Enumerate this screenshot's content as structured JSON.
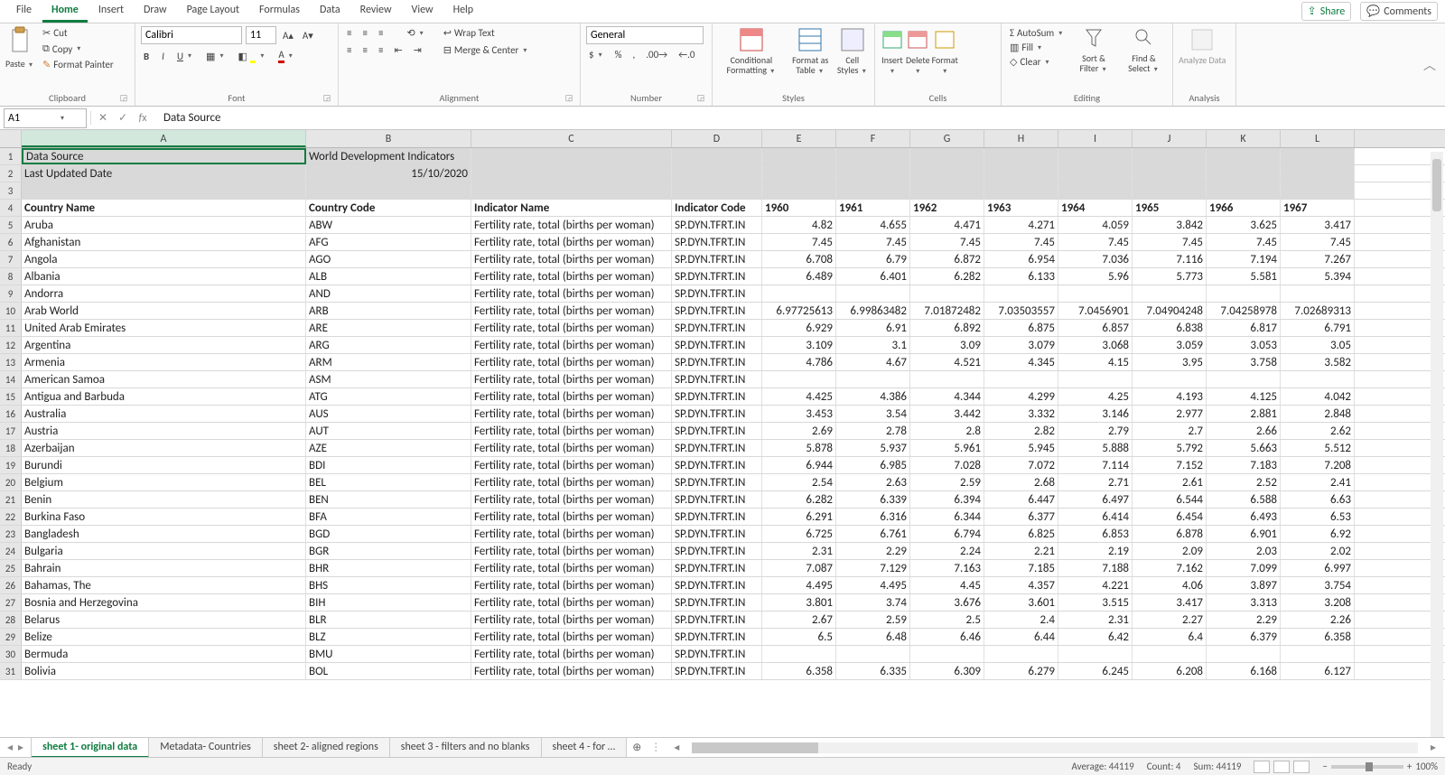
{
  "menu": {
    "tabs": [
      "File",
      "Home",
      "Insert",
      "Draw",
      "Page Layout",
      "Formulas",
      "Data",
      "Review",
      "View",
      "Help"
    ],
    "active": 1,
    "share": "Share",
    "comments": "Comments"
  },
  "ribbon": {
    "clipboard": {
      "paste": "Paste",
      "cut": "Cut",
      "copy": "Copy",
      "fp": "Format Painter",
      "label": "Clipboard"
    },
    "font": {
      "name": "Calibri",
      "size": "11",
      "label": "Font"
    },
    "alignment": {
      "wrap": "Wrap Text",
      "merge": "Merge & Center",
      "label": "Alignment"
    },
    "number": {
      "format": "General",
      "label": "Number"
    },
    "styles": {
      "cf": "Conditional Formatting",
      "fat": "Format as Table",
      "cs": "Cell Styles",
      "label": "Styles"
    },
    "cells": {
      "insert": "Insert",
      "delete": "Delete",
      "format": "Format",
      "label": "Cells"
    },
    "editing": {
      "autosum": "AutoSum",
      "fill": "Fill",
      "clear": "Clear",
      "sort": "Sort & Filter",
      "find": "Find & Select",
      "label": "Editing"
    },
    "analysis": {
      "analyze": "Analyze Data",
      "label": "Analysis"
    }
  },
  "namebox": "A1",
  "formula": "Data Source",
  "columns": [
    "A",
    "B",
    "C",
    "D",
    "E",
    "F",
    "G",
    "H",
    "I",
    "J",
    "K",
    "L"
  ],
  "colWidths": [
    "cA",
    "cB",
    "cC",
    "cD",
    "cE",
    "cF",
    "cG",
    "cH",
    "cI",
    "cJ",
    "cK",
    "cL"
  ],
  "headerMeta": [
    {
      "n": 1,
      "a": "Data Source",
      "b": "World Development Indicators",
      "sel": true
    },
    {
      "n": 2,
      "a": "Last Updated Date",
      "b_num": "15/10/2020",
      "sel": true
    },
    {
      "n": 3,
      "a": "",
      "b": "",
      "sel": true
    }
  ],
  "colHeaders": {
    "n": 4,
    "cells": [
      "Country Name",
      "Country Code",
      "Indicator Name",
      "Indicator Code",
      "1960",
      "1961",
      "1962",
      "1963",
      "1964",
      "1965",
      "1966",
      "1967"
    ]
  },
  "chart_data": {
    "type": "table",
    "title": "World Development Indicators — Fertility rate, total (births per woman)",
    "indicator_code": "SP.DYN.TFRT.IN",
    "years": [
      "1960",
      "1961",
      "1962",
      "1963",
      "1964",
      "1965",
      "1966",
      "1967"
    ],
    "rows": [
      {
        "n": 5,
        "country": "Aruba",
        "code": "ABW",
        "v": [
          "4.82",
          "4.655",
          "4.471",
          "4.271",
          "4.059",
          "3.842",
          "3.625",
          "3.417"
        ]
      },
      {
        "n": 6,
        "country": "Afghanistan",
        "code": "AFG",
        "v": [
          "7.45",
          "7.45",
          "7.45",
          "7.45",
          "7.45",
          "7.45",
          "7.45",
          "7.45"
        ]
      },
      {
        "n": 7,
        "country": "Angola",
        "code": "AGO",
        "v": [
          "6.708",
          "6.79",
          "6.872",
          "6.954",
          "7.036",
          "7.116",
          "7.194",
          "7.267"
        ]
      },
      {
        "n": 8,
        "country": "Albania",
        "code": "ALB",
        "v": [
          "6.489",
          "6.401",
          "6.282",
          "6.133",
          "5.96",
          "5.773",
          "5.581",
          "5.394"
        ]
      },
      {
        "n": 9,
        "country": "Andorra",
        "code": "AND",
        "v": [
          "",
          "",
          "",
          "",
          "",
          "",
          "",
          ""
        ]
      },
      {
        "n": 10,
        "country": "Arab World",
        "code": "ARB",
        "v": [
          "6.97725613",
          "6.99863482",
          "7.01872482",
          "7.03503557",
          "7.0456901",
          "7.04904248",
          "7.04258978",
          "7.02689313"
        ]
      },
      {
        "n": 11,
        "country": "United Arab Emirates",
        "code": "ARE",
        "v": [
          "6.929",
          "6.91",
          "6.892",
          "6.875",
          "6.857",
          "6.838",
          "6.817",
          "6.791"
        ]
      },
      {
        "n": 12,
        "country": "Argentina",
        "code": "ARG",
        "v": [
          "3.109",
          "3.1",
          "3.09",
          "3.079",
          "3.068",
          "3.059",
          "3.053",
          "3.05"
        ]
      },
      {
        "n": 13,
        "country": "Armenia",
        "code": "ARM",
        "v": [
          "4.786",
          "4.67",
          "4.521",
          "4.345",
          "4.15",
          "3.95",
          "3.758",
          "3.582"
        ]
      },
      {
        "n": 14,
        "country": "American Samoa",
        "code": "ASM",
        "v": [
          "",
          "",
          "",
          "",
          "",
          "",
          "",
          ""
        ]
      },
      {
        "n": 15,
        "country": "Antigua and Barbuda",
        "code": "ATG",
        "v": [
          "4.425",
          "4.386",
          "4.344",
          "4.299",
          "4.25",
          "4.193",
          "4.125",
          "4.042"
        ]
      },
      {
        "n": 16,
        "country": "Australia",
        "code": "AUS",
        "v": [
          "3.453",
          "3.54",
          "3.442",
          "3.332",
          "3.146",
          "2.977",
          "2.881",
          "2.848"
        ]
      },
      {
        "n": 17,
        "country": "Austria",
        "code": "AUT",
        "v": [
          "2.69",
          "2.78",
          "2.8",
          "2.82",
          "2.79",
          "2.7",
          "2.66",
          "2.62"
        ]
      },
      {
        "n": 18,
        "country": "Azerbaijan",
        "code": "AZE",
        "v": [
          "5.878",
          "5.937",
          "5.961",
          "5.945",
          "5.888",
          "5.792",
          "5.663",
          "5.512"
        ]
      },
      {
        "n": 19,
        "country": "Burundi",
        "code": "BDI",
        "v": [
          "6.944",
          "6.985",
          "7.028",
          "7.072",
          "7.114",
          "7.152",
          "7.183",
          "7.208"
        ]
      },
      {
        "n": 20,
        "country": "Belgium",
        "code": "BEL",
        "v": [
          "2.54",
          "2.63",
          "2.59",
          "2.68",
          "2.71",
          "2.61",
          "2.52",
          "2.41"
        ]
      },
      {
        "n": 21,
        "country": "Benin",
        "code": "BEN",
        "v": [
          "6.282",
          "6.339",
          "6.394",
          "6.447",
          "6.497",
          "6.544",
          "6.588",
          "6.63"
        ]
      },
      {
        "n": 22,
        "country": "Burkina Faso",
        "code": "BFA",
        "v": [
          "6.291",
          "6.316",
          "6.344",
          "6.377",
          "6.414",
          "6.454",
          "6.493",
          "6.53"
        ]
      },
      {
        "n": 23,
        "country": "Bangladesh",
        "code": "BGD",
        "v": [
          "6.725",
          "6.761",
          "6.794",
          "6.825",
          "6.853",
          "6.878",
          "6.901",
          "6.92"
        ]
      },
      {
        "n": 24,
        "country": "Bulgaria",
        "code": "BGR",
        "v": [
          "2.31",
          "2.29",
          "2.24",
          "2.21",
          "2.19",
          "2.09",
          "2.03",
          "2.02"
        ]
      },
      {
        "n": 25,
        "country": "Bahrain",
        "code": "BHR",
        "v": [
          "7.087",
          "7.129",
          "7.163",
          "7.185",
          "7.188",
          "7.162",
          "7.099",
          "6.997"
        ]
      },
      {
        "n": 26,
        "country": "Bahamas, The",
        "code": "BHS",
        "v": [
          "4.495",
          "4.495",
          "4.45",
          "4.357",
          "4.221",
          "4.06",
          "3.897",
          "3.754"
        ]
      },
      {
        "n": 27,
        "country": "Bosnia and Herzegovina",
        "code": "BIH",
        "v": [
          "3.801",
          "3.74",
          "3.676",
          "3.601",
          "3.515",
          "3.417",
          "3.313",
          "3.208"
        ]
      },
      {
        "n": 28,
        "country": "Belarus",
        "code": "BLR",
        "v": [
          "2.67",
          "2.59",
          "2.5",
          "2.4",
          "2.31",
          "2.27",
          "2.29",
          "2.26"
        ]
      },
      {
        "n": 29,
        "country": "Belize",
        "code": "BLZ",
        "v": [
          "6.5",
          "6.48",
          "6.46",
          "6.44",
          "6.42",
          "6.4",
          "6.379",
          "6.358"
        ]
      },
      {
        "n": 30,
        "country": "Bermuda",
        "code": "BMU",
        "v": [
          "",
          "",
          "",
          "",
          "",
          "",
          "",
          ""
        ]
      },
      {
        "n": 31,
        "country": "Bolivia",
        "code": "BOL",
        "v": [
          "6.358",
          "6.335",
          "6.309",
          "6.279",
          "6.245",
          "6.208",
          "6.168",
          "6.127"
        ]
      }
    ]
  },
  "indicator_name": "Fertility rate, total (births per woman)",
  "indicator_code": "SP.DYN.TFRT.IN",
  "sheets": {
    "tabs": [
      "sheet 1- original data",
      "Metadata- Countries",
      "sheet 2- aligned regions",
      "sheet 3 - filters and no blanks",
      "sheet 4 - for …"
    ],
    "active": 0
  },
  "status": {
    "ready": "Ready",
    "avg": "Average: 44119",
    "count": "Count: 4",
    "sum": "Sum: 44119",
    "zoom": "100%"
  }
}
